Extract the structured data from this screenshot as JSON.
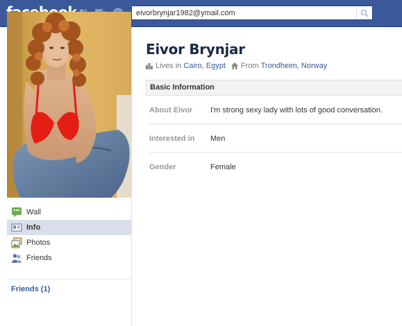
{
  "topbar": {
    "logo": "facebook",
    "search_value": "eivorbrynjar1982@ymail.com"
  },
  "colors": {
    "brand": "#3b5998",
    "link": "#3b5998",
    "name": "#1c2a47"
  },
  "icons": {
    "friends_jewel": "friends-icon",
    "messages_jewel": "messages-icon",
    "notifications_jewel": "globe-icon",
    "search": "search-icon"
  },
  "sidebar": {
    "items": [
      {
        "label": "Wall",
        "icon": "wall-icon"
      },
      {
        "label": "Info",
        "icon": "info-icon",
        "active": true
      },
      {
        "label": "Photos",
        "icon": "photos-icon"
      },
      {
        "label": "Friends",
        "icon": "friends-icon"
      }
    ],
    "friends_header": "Friends (1)"
  },
  "profile": {
    "name": "Eivor Brynjar",
    "lives_in_label": "Lives in",
    "lives_in": "Cairo, Egypt",
    "from_label": "From",
    "from": "Trondheim, Norway"
  },
  "basic_info": {
    "title": "Basic Information",
    "rows": [
      {
        "label": "About Eivor",
        "value": "I'm strong sexy lady with lots of good conversation."
      },
      {
        "label": "Interested in",
        "value": "Men"
      },
      {
        "label": "Gender",
        "value": "Female"
      }
    ]
  }
}
